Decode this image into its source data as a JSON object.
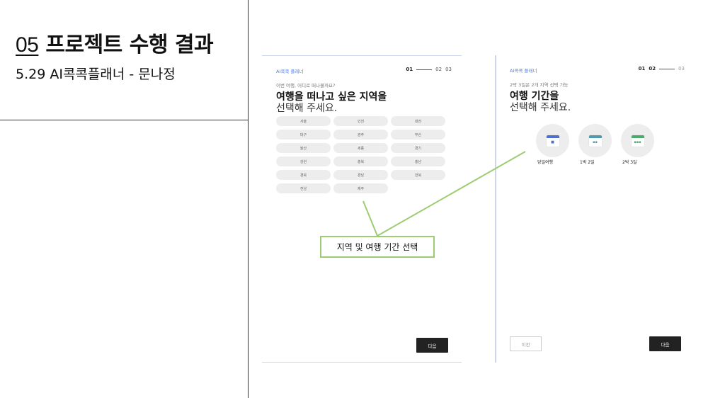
{
  "slide": {
    "number": "05",
    "title": "프로젝트 수행 결과",
    "subtitle": "5.29 AI콕콕플래너 - 문나정"
  },
  "screen1": {
    "brand": "AI콕콕 플래너",
    "steps": [
      "01",
      "02",
      "03"
    ],
    "question": "이번 여행, 어디로 떠나볼까요?",
    "heading_line1": "여행을 떠나고 싶은 지역을",
    "heading_line2": "선택해 주세요.",
    "regions": [
      "서울",
      "인천",
      "대전",
      "대구",
      "광주",
      "부산",
      "울산",
      "세종",
      "경기",
      "강원",
      "충북",
      "충남",
      "경북",
      "경남",
      "전북",
      "전남",
      "제주"
    ],
    "next_label": "다음"
  },
  "screen2": {
    "brand": "AI콕콕 플래너",
    "steps": [
      "01",
      "02",
      "03"
    ],
    "hint": "2박 3일은 2개 지역 선택 가능",
    "heading_line1": "여행 기간을",
    "heading_line2": "선택해 주세요.",
    "durations": [
      {
        "label": "당일여행",
        "icon": "calendar-icon",
        "color": "#4c6fd0"
      },
      {
        "label": "1박 2일",
        "icon": "calendar-icon",
        "color": "#4f9ab0"
      },
      {
        "label": "2박 3일",
        "icon": "calendar-icon",
        "color": "#4caa6a"
      }
    ],
    "prev_label": "이전",
    "next_label": "다음"
  },
  "callout": {
    "text": "지역 및 여행 기간 선택",
    "border_color": "#9dcc72"
  }
}
